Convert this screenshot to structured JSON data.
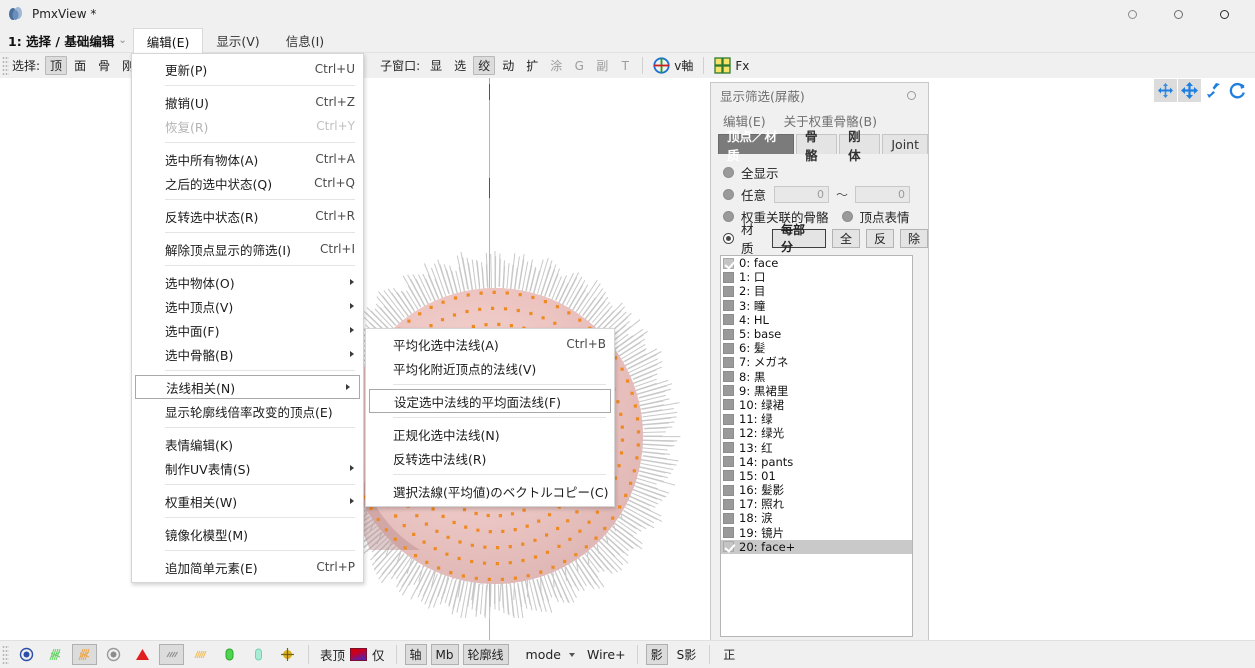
{
  "window": {
    "title": "PmxView *",
    "app_icon": "pmx-app-icon",
    "controls": [
      {
        "name": "minimize-button",
        "glyph": "○"
      },
      {
        "name": "maximize-button",
        "glyph": "○"
      },
      {
        "name": "close-button",
        "glyph": "○"
      }
    ]
  },
  "tabbar": {
    "mode_label": "1: 选择 / 基础编辑",
    "mode_caret": "⌄",
    "tabs": [
      {
        "label": "编辑(E)",
        "active": true
      },
      {
        "label": "显示(V)",
        "active": false
      },
      {
        "label": "信息(I)",
        "active": false
      }
    ]
  },
  "toolbar": {
    "select_label": "选择:",
    "select_buttons": [
      {
        "label": "顶",
        "on": true
      },
      {
        "label": "面",
        "on": false
      },
      {
        "label": "骨",
        "on": false
      },
      {
        "label": "刚",
        "on": false
      }
    ],
    "subwindow_label": "子窗口:",
    "subwindow_buttons": [
      {
        "label": "显",
        "on": false,
        "dim": false
      },
      {
        "label": "选",
        "on": false,
        "dim": false
      },
      {
        "label": "绞",
        "on": true,
        "dim": false
      },
      {
        "label": "动",
        "on": false,
        "dim": false
      },
      {
        "label": "扩",
        "on": false,
        "dim": false
      },
      {
        "label": "涂",
        "on": false,
        "dim": true
      },
      {
        "label": "G",
        "on": false,
        "dim": true
      },
      {
        "label": "副",
        "on": false,
        "dim": true
      },
      {
        "label": "T",
        "on": false,
        "dim": true
      }
    ],
    "axis_icon": "axis-cross-icon",
    "axis_label": "v軸",
    "grid_icon": "grid-icon",
    "fx_label": "Fx"
  },
  "viewport": {
    "gizmos": [
      {
        "name": "pan-horizontal-gizmo",
        "on": true
      },
      {
        "name": "move-gizmo",
        "on": true
      },
      {
        "name": "zoom-gizmo",
        "on": false
      },
      {
        "name": "rotate-gizmo",
        "on": false
      }
    ]
  },
  "edit_menu": {
    "items": [
      {
        "label": "更新(P)",
        "accel": "Ctrl+U",
        "disabled": false,
        "submenu": false,
        "sep_after": true
      },
      {
        "label": "撤销(U)",
        "accel": "Ctrl+Z",
        "disabled": false,
        "submenu": false
      },
      {
        "label": "恢复(R)",
        "accel": "Ctrl+Y",
        "disabled": true,
        "submenu": false,
        "sep_after": true
      },
      {
        "label": "选中所有物体(A)",
        "accel": "Ctrl+A",
        "disabled": false,
        "submenu": false
      },
      {
        "label": "之后的选中状态(Q)",
        "accel": "Ctrl+Q",
        "disabled": false,
        "submenu": false,
        "sep_after": true
      },
      {
        "label": "反转选中状态(R)",
        "accel": "Ctrl+R",
        "disabled": false,
        "submenu": false,
        "sep_after": true
      },
      {
        "label": "解除顶点显示的筛选(I)",
        "accel": "Ctrl+I",
        "disabled": false,
        "submenu": false,
        "sep_after": true
      },
      {
        "label": "选中物体(O)",
        "accel": "",
        "disabled": false,
        "submenu": true
      },
      {
        "label": "选中顶点(V)",
        "accel": "",
        "disabled": false,
        "submenu": true
      },
      {
        "label": "选中面(F)",
        "accel": "",
        "disabled": false,
        "submenu": true
      },
      {
        "label": "选中骨骼(B)",
        "accel": "",
        "disabled": false,
        "submenu": true,
        "sep_after": true
      },
      {
        "label": "法线相关(N)",
        "accel": "",
        "disabled": false,
        "submenu": true,
        "highlighted": true
      },
      {
        "label": "显示轮廓线倍率改变的顶点(E)",
        "accel": "",
        "disabled": false,
        "submenu": false,
        "sep_after": true
      },
      {
        "label": "表情编辑(K)",
        "accel": "",
        "disabled": false,
        "submenu": false
      },
      {
        "label": "制作UV表情(S)",
        "accel": "",
        "disabled": false,
        "submenu": true,
        "sep_after": true
      },
      {
        "label": "权重相关(W)",
        "accel": "",
        "disabled": false,
        "submenu": true,
        "sep_after": true
      },
      {
        "label": "镜像化模型(M)",
        "accel": "",
        "disabled": false,
        "submenu": false,
        "sep_after": true
      },
      {
        "label": "追加简单元素(E)",
        "accel": "Ctrl+P",
        "disabled": false,
        "submenu": false
      }
    ]
  },
  "normal_submenu": {
    "items": [
      {
        "label": "平均化选中法线(A)",
        "accel": "Ctrl+B",
        "disabled": false
      },
      {
        "label": "平均化附近顶点的法线(V)",
        "accel": "",
        "disabled": false,
        "sep_after": true
      },
      {
        "label": "设定选中法线的平均面法线(F)",
        "accel": "",
        "disabled": false,
        "highlighted": true,
        "sep_after": true
      },
      {
        "label": "正规化选中法线(N)",
        "accel": "",
        "disabled": false
      },
      {
        "label": "反转选中法线(R)",
        "accel": "",
        "disabled": false,
        "sep_after": true
      },
      {
        "label": "選択法線(平均値)のベクトルコピー(C)",
        "accel": "",
        "disabled": false
      }
    ]
  },
  "filter_panel": {
    "title": "显示筛选(屏蔽)",
    "close_icon": "circle-icon",
    "menu": [
      "编辑(E)",
      "关于权重骨骼(B)"
    ],
    "tabs": [
      {
        "label": "顶点／材质",
        "active": true
      },
      {
        "label": "骨骼",
        "active": false
      },
      {
        "label": "刚体",
        "active": false
      },
      {
        "label": "Joint",
        "active": false
      }
    ],
    "options": [
      {
        "label": "全显示",
        "selected": false
      },
      {
        "label": "任意",
        "selected": false
      },
      {
        "label": "权重关联的骨骼",
        "selected": false
      },
      {
        "label": "顶点表情",
        "selected": false
      },
      {
        "label": "材质",
        "selected": true
      }
    ],
    "range_from": "0",
    "range_to": "0",
    "tilde": "～",
    "buttons": [
      {
        "label": "每部分",
        "strong": true
      },
      {
        "label": "全",
        "strong": false
      },
      {
        "label": "反",
        "strong": false
      },
      {
        "label": "除",
        "strong": false
      }
    ],
    "materials": [
      {
        "label": "0: face",
        "checked": true,
        "selected": false
      },
      {
        "label": "1: 口",
        "checked": false,
        "selected": false
      },
      {
        "label": "2: 目",
        "checked": false,
        "selected": false
      },
      {
        "label": "3: 瞳",
        "checked": false,
        "selected": false
      },
      {
        "label": "4: HL",
        "checked": false,
        "selected": false
      },
      {
        "label": "5: base",
        "checked": false,
        "selected": false
      },
      {
        "label": "6: 髪",
        "checked": false,
        "selected": false
      },
      {
        "label": "7: メガネ",
        "checked": false,
        "selected": false
      },
      {
        "label": "8: 黒",
        "checked": false,
        "selected": false
      },
      {
        "label": "9: 黒裙里",
        "checked": false,
        "selected": false
      },
      {
        "label": "10: 绿裙",
        "checked": false,
        "selected": false
      },
      {
        "label": "11: 绿",
        "checked": false,
        "selected": false
      },
      {
        "label": "12: 绿光",
        "checked": false,
        "selected": false
      },
      {
        "label": "13: 红",
        "checked": false,
        "selected": false
      },
      {
        "label": "14: pants",
        "checked": false,
        "selected": false
      },
      {
        "label": "15: 01",
        "checked": false,
        "selected": false
      },
      {
        "label": "16: 髪影",
        "checked": false,
        "selected": false
      },
      {
        "label": "17: 照れ",
        "checked": false,
        "selected": false
      },
      {
        "label": "18: 涙",
        "checked": false,
        "selected": false
      },
      {
        "label": "19: 镜片",
        "checked": false,
        "selected": false
      },
      {
        "label": "20: face+",
        "checked": true,
        "selected": true
      }
    ]
  },
  "statusbar": {
    "icon_buttons": [
      {
        "name": "vertex-dot-icon",
        "on": false
      },
      {
        "name": "green-scribble-icon",
        "on": false
      },
      {
        "name": "orange-scribble-icon",
        "on": true
      },
      {
        "name": "gray-dot-icon",
        "on": false
      },
      {
        "name": "red-triangle-icon",
        "on": false
      },
      {
        "name": "gray-hatch-icon",
        "on": true
      },
      {
        "name": "orange-hatch-icon",
        "on": false
      },
      {
        "name": "green-capsule-icon",
        "on": false
      },
      {
        "name": "teal-capsule-icon",
        "on": false
      },
      {
        "name": "yellow-joint-icon",
        "on": false
      }
    ],
    "texture_label": "表顶",
    "color_swatch": "color-swatch",
    "only_label": "仅",
    "mode_buttons": [
      {
        "label": "轴",
        "on": true
      },
      {
        "label": "Mb",
        "on": true
      },
      {
        "label": "轮廓线",
        "on": true
      }
    ],
    "mode_label": "mode",
    "mode_caret": "▾",
    "wire_label": "Wire+",
    "shadow_buttons": [
      {
        "label": "影",
        "on": true
      },
      {
        "label": "S影",
        "on": false
      }
    ],
    "front_label": "正"
  }
}
